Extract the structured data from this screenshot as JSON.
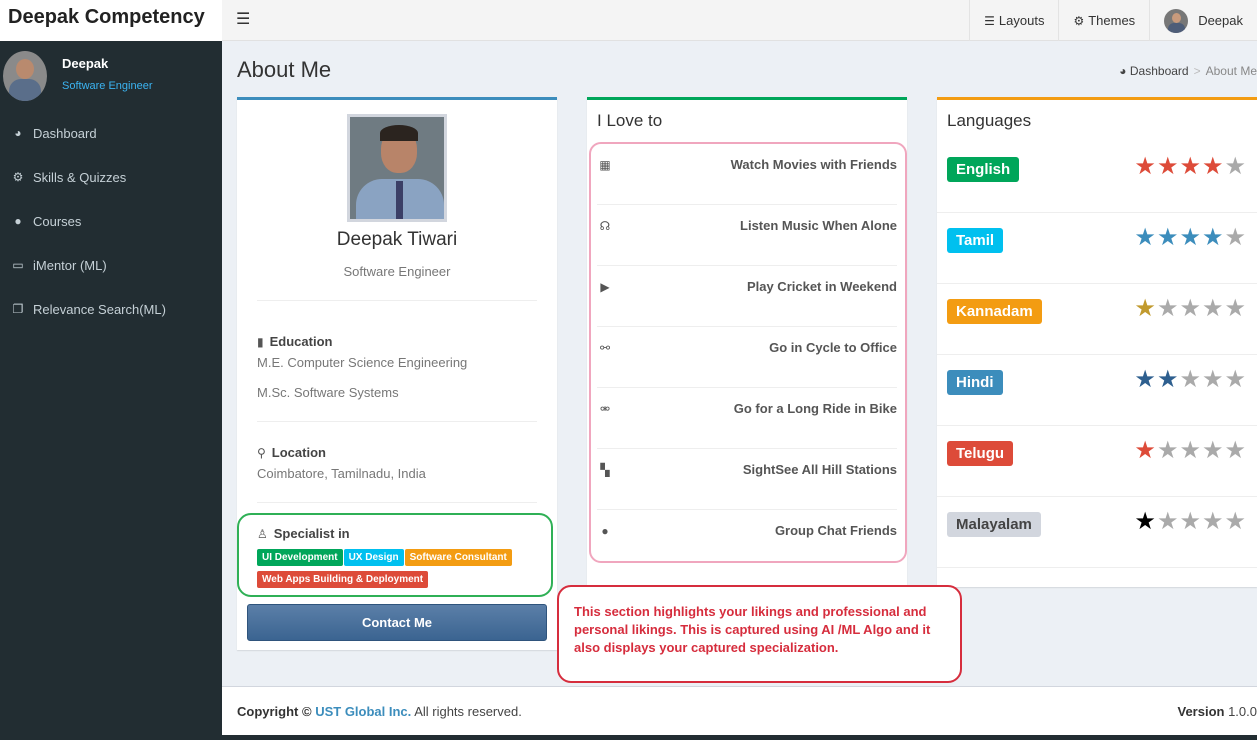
{
  "app": {
    "brand": "Deepak Competency"
  },
  "user": {
    "name": "Deepak",
    "role": "Software Engineer"
  },
  "sidebar": {
    "items": [
      {
        "label": "Dashboard",
        "icon": "dashboard-icon"
      },
      {
        "label": "Skills & Quizzes",
        "icon": "gears-icon"
      },
      {
        "label": "Courses",
        "icon": "globe-icon"
      },
      {
        "label": "iMentor (ML)",
        "icon": "laptop-icon"
      },
      {
        "label": "Relevance Search(ML)",
        "icon": "copy-icon"
      }
    ]
  },
  "topbar": {
    "layouts": "Layouts",
    "themes": "Themes",
    "user": "Deepak"
  },
  "page": {
    "title": "About Me"
  },
  "breadcrumb": {
    "home": "Dashboard",
    "sep": ">",
    "current": "About Me"
  },
  "profile": {
    "name": "Deepak Tiwari",
    "role": "Software Engineer",
    "education_title": "Education",
    "education": [
      "M.E. Computer Science Engineering",
      "M.Sc. Software Systems"
    ],
    "location_title": "Location",
    "location": "Coimbatore, Tamilnadu, India",
    "specialist_title": "Specialist in",
    "specialties": [
      {
        "label": "UI Development",
        "color": "#00a65a"
      },
      {
        "label": "UX Design",
        "color": "#00c0ef"
      },
      {
        "label": "Software Consultant",
        "color": "#f39c12"
      },
      {
        "label": "Web Apps Building & Deployment",
        "color": "#dd4b39"
      }
    ],
    "contact": "Contact Me"
  },
  "love": {
    "title": "I Love to",
    "items": [
      {
        "label": "Watch Movies with Friends",
        "icon": "film-icon"
      },
      {
        "label": "Listen Music When Alone",
        "icon": "headphones-icon"
      },
      {
        "label": "Play Cricket in Weekend",
        "icon": "play-icon"
      },
      {
        "label": "Go in Cycle to Office",
        "icon": "bicycle-icon"
      },
      {
        "label": "Go for a Long Ride in Bike",
        "icon": "motorcycle-icon"
      },
      {
        "label": "SightSee All Hill Stations",
        "icon": "binoculars-icon"
      },
      {
        "label": "Group Chat Friends",
        "icon": "wechat-icon"
      }
    ]
  },
  "languages": {
    "title": "Languages",
    "items": [
      {
        "name": "English",
        "color": "#00a65a",
        "rating": 4,
        "star_color": "#dd4b39"
      },
      {
        "name": "Tamil",
        "color": "#00c0ef",
        "rating": 4,
        "star_color": "#3c8dbc"
      },
      {
        "name": "Kannadam",
        "color": "#f39c12",
        "rating": 1,
        "star_color": "#c19a2e"
      },
      {
        "name": "Hindi",
        "color": "#3c8dbc",
        "rating": 2,
        "star_color": "#2e5f8f"
      },
      {
        "name": "Telugu",
        "color": "#dd4b39",
        "rating": 1,
        "star_color": "#dd4b39"
      },
      {
        "name": "Malayalam",
        "color": "#d2d6de",
        "text_color": "#444444",
        "rating": 1,
        "star_color": "#000000"
      }
    ]
  },
  "callout": {
    "text": "This section highlights your likings and professional and personal likings. This is captured using AI /ML Algo and it also displays your captured specialization."
  },
  "footer": {
    "copyright": "Copyright ©",
    "company": "UST Global Inc.",
    "rights": "All rights reserved.",
    "version_label": "Version",
    "version": "1.0.0"
  }
}
